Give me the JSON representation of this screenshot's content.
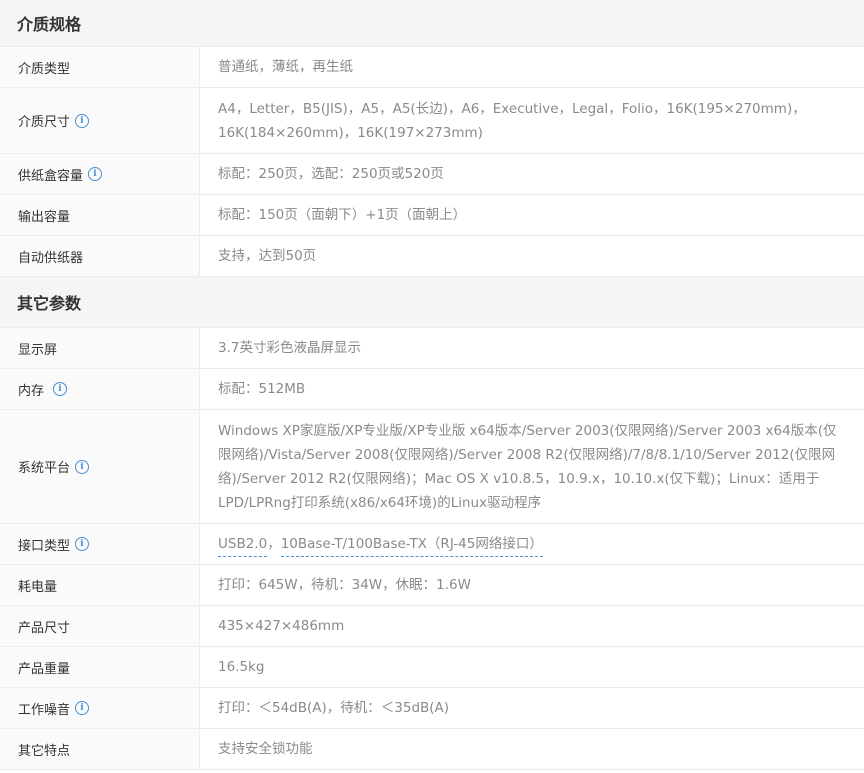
{
  "sections": [
    {
      "title": "介质规格",
      "rows": [
        {
          "label": "介质类型",
          "info": false,
          "value": "普通纸，薄纸，再生纸"
        },
        {
          "label": "介质尺寸",
          "info": true,
          "value": "A4，Letter，B5(JIS)，A5，A5(长边)，A6，Executive，Legal，Folio，16K(195×270mm)，16K(184×260mm)，16K(197×273mm)"
        },
        {
          "label": "供纸盒容量",
          "info": true,
          "value": "标配：250页，选配：250页或520页"
        },
        {
          "label": "输出容量",
          "info": false,
          "value": "标配：150页（面朝下）+1页（面朝上）"
        },
        {
          "label": "自动供纸器",
          "info": false,
          "value": "支持，达到50页"
        }
      ]
    },
    {
      "title": "其它参数",
      "rows": [
        {
          "label": "显示屏",
          "info": false,
          "value": "3.7英寸彩色液晶屏显示"
        },
        {
          "label": "内存",
          "info": true,
          "value": "标配：512MB"
        },
        {
          "label": "系统平台",
          "info": true,
          "value": "Windows XP家庭版/XP专业版/XP专业版 x64版本/Server 2003(仅限网络)/Server 2003 x64版本(仅限网络)/Vista/Server 2008(仅限网络)/Server 2008 R2(仅限网络)/7/8/8.1/10/Server 2012(仅限网络)/Server 2012 R2(仅限网络)；Mac OS X v10.8.5，10.9.x，10.10.x(仅下载)；Linux：适用于LPD/LPRng打印系统(x86/x64环境)的Linux驱动程序"
        },
        {
          "label": "接口类型",
          "info": true,
          "links": [
            "USB2.0",
            "10Base-T/100Base-TX（RJ-45网络接口）"
          ],
          "separator": "，"
        },
        {
          "label": "耗电量",
          "info": false,
          "value": "打印：645W，待机：34W，休眠：1.6W"
        },
        {
          "label": "产品尺寸",
          "info": false,
          "value": "435×427×486mm"
        },
        {
          "label": "产品重量",
          "info": false,
          "value": "16.5kg"
        },
        {
          "label": "工作噪音",
          "info": true,
          "value": "打印：＜54dB(A)，待机：＜35dB(A)"
        },
        {
          "label": "其它特点",
          "info": false,
          "value": "支持安全锁功能"
        }
      ]
    }
  ],
  "icons": {
    "info": "info-circle-icon",
    "info_glyph": "i",
    "accent": "#4a90d9"
  }
}
